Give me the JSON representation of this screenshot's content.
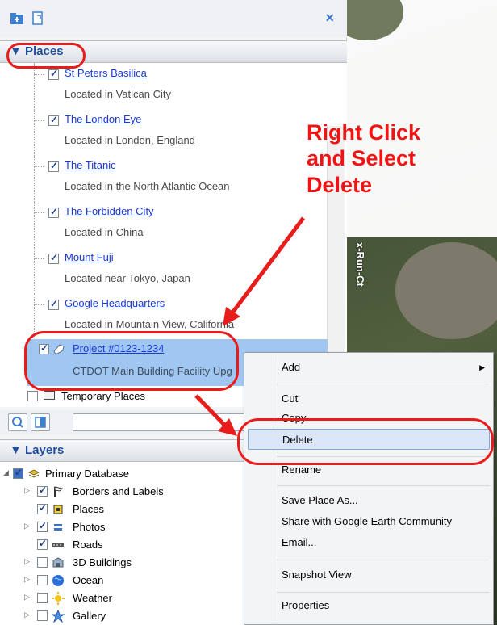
{
  "sidebar": {
    "close_symbol": "×",
    "places_header": "▼ Places",
    "layers_header": "▼ Layers",
    "places": [
      {
        "name": "St Peters Basilica",
        "desc": "Located in Vatican City"
      },
      {
        "name": "The London Eye",
        "desc": "Located in London, England"
      },
      {
        "name": "The Titanic",
        "desc": "Located in the North Atlantic Ocean"
      },
      {
        "name": "The Forbidden City",
        "desc": "Located in China"
      },
      {
        "name": "Mount Fuji",
        "desc": "Located near Tokyo, Japan"
      },
      {
        "name": "Google Headquarters",
        "desc": "Located in Mountain View, California"
      }
    ],
    "project": {
      "name": "Project #0123-1234",
      "desc": "CTDOT Main Building Facility Upg"
    },
    "temporary_places": "Temporary Places",
    "layers": [
      {
        "name": "Primary Database",
        "checked": true
      },
      {
        "name": "Borders and Labels",
        "checked": true
      },
      {
        "name": "Places",
        "checked": true
      },
      {
        "name": "Photos",
        "checked": true
      },
      {
        "name": "Roads",
        "checked": true
      },
      {
        "name": "3D Buildings",
        "checked": false
      },
      {
        "name": "Ocean",
        "checked": false
      },
      {
        "name": "Weather",
        "checked": false
      },
      {
        "name": "Gallery",
        "checked": false
      }
    ]
  },
  "map": {
    "road_label": "x-Run-Ct"
  },
  "annotation": {
    "line1": "Right Click",
    "line2": "and Select",
    "line3": "Delete",
    "color": "#f01414"
  },
  "context_menu": {
    "items": [
      "Add",
      "Cut",
      "Copy",
      "Delete",
      "Rename",
      "Save Place As...",
      "Share with Google Earth Community",
      "Email...",
      "Snapshot View",
      "Properties"
    ],
    "highlighted": "Delete"
  },
  "icons": [
    "add-folder-icon",
    "add-placemark-icon",
    "close-icon",
    "search-icon",
    "panel-toggle-icon",
    "polygon-icon",
    "folder-icon",
    "database-icon",
    "borders-icon",
    "places-icon",
    "photos-icon",
    "roads-icon",
    "buildings-icon",
    "ocean-icon",
    "weather-icon",
    "gallery-icon"
  ]
}
